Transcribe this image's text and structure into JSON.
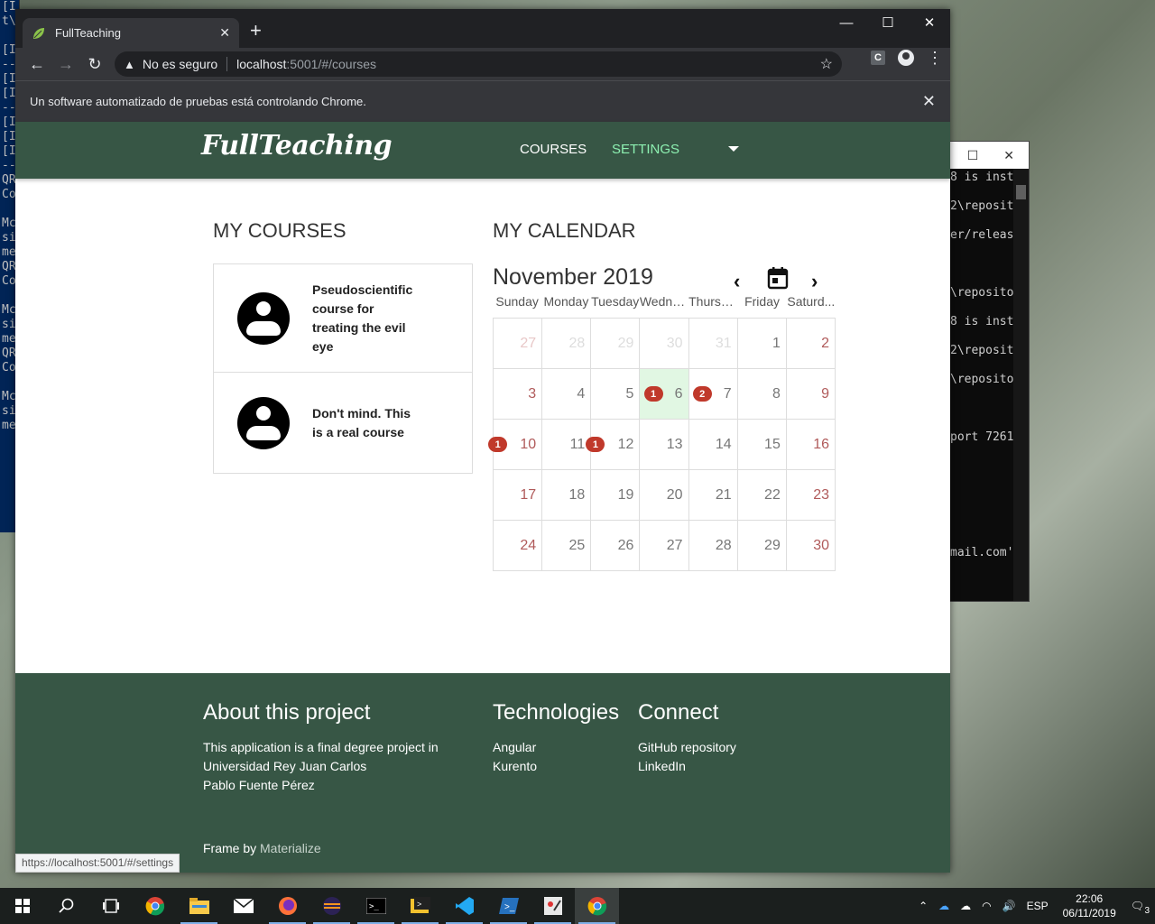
{
  "background": {
    "ps_lines": [
      "[I",
      "t\\",
      "",
      "[I",
      "--",
      "[I",
      "[I",
      "--",
      "[I",
      "[I",
      "[I",
      "--",
      "QR",
      "Co",
      "",
      "Mc",
      "si",
      "me",
      "QR",
      "Co",
      "",
      "Mc",
      "si",
      "me",
      "QR",
      "Co",
      "",
      "Mc",
      "si",
      "me"
    ],
    "cmd_lines": [
      "8 is inst",
      "2\\reposit",
      "er/releas",
      "\\reposito",
      "8 is inst",
      "2\\reposit",
      "\\reposito",
      "port 7261",
      "mail.com'"
    ],
    "cmd_controls": {
      "maximize": "☐",
      "close": "✕"
    }
  },
  "browser": {
    "tab_title": "FullTeaching",
    "tab_close": "✕",
    "new_tab": "+",
    "window_controls": [
      "—",
      "☐",
      "✕"
    ],
    "nav": {
      "back": "←",
      "forward": "→",
      "reload": "↻"
    },
    "security_text": "No es seguro",
    "url_host": "localhost",
    "url_rest": ":5001/#/courses",
    "ext_label": "C",
    "menu": "⋮",
    "infobar_text": "Un software automatizado de pruebas está controlando Chrome.",
    "status_url": "https://localhost:5001/#/settings"
  },
  "site": {
    "brand": "FullTeaching",
    "nav": {
      "courses": "COURSES",
      "settings": "SETTINGS"
    },
    "my_courses_title": "MY COURSES",
    "courses": [
      {
        "name": "Pseudoscientific course for treating the evil eye"
      },
      {
        "name": "Don't mind. This is a real course"
      }
    ],
    "my_calendar_title": "MY CALENDAR",
    "calendar": {
      "month": "November 2019",
      "prev": "‹",
      "next": "›",
      "day_headers": [
        "Sunday",
        "Monday",
        "Tuesday",
        "Wedne...",
        "Thursd...",
        "Friday",
        "Saturd..."
      ]
    },
    "footer": {
      "about_title": "About this project",
      "about_lines": [
        "This application is a final degree project in",
        "Universidad Rey Juan Carlos",
        "Pablo Fuente Pérez"
      ],
      "tech_title": "Technologies",
      "tech_items": [
        "Angular",
        "Kurento"
      ],
      "connect_title": "Connect",
      "connect_items": [
        "GitHub repository",
        "LinkedIn"
      ],
      "frame_by": "Frame by",
      "materialize": "Materialize"
    }
  },
  "calendar_cells": [
    {
      "day": "27",
      "muted": true,
      "weekend": true
    },
    {
      "day": "28",
      "muted": true
    },
    {
      "day": "29",
      "muted": true
    },
    {
      "day": "30",
      "muted": true
    },
    {
      "day": "31",
      "muted": true
    },
    {
      "day": "1"
    },
    {
      "day": "2",
      "weekend": true
    },
    {
      "day": "3",
      "weekend": true
    },
    {
      "day": "4"
    },
    {
      "day": "5"
    },
    {
      "day": "6",
      "today": true,
      "badge": "1"
    },
    {
      "day": "7",
      "badge": "2"
    },
    {
      "day": "8"
    },
    {
      "day": "9",
      "weekend": true
    },
    {
      "day": "10",
      "weekend": true,
      "badge": "1"
    },
    {
      "day": "11"
    },
    {
      "day": "12",
      "badge": "1"
    },
    {
      "day": "13"
    },
    {
      "day": "14"
    },
    {
      "day": "15"
    },
    {
      "day": "16",
      "weekend": true
    },
    {
      "day": "17",
      "weekend": true
    },
    {
      "day": "18"
    },
    {
      "day": "19"
    },
    {
      "day": "20"
    },
    {
      "day": "21"
    },
    {
      "day": "22"
    },
    {
      "day": "23",
      "weekend": true
    },
    {
      "day": "24",
      "weekend": true
    },
    {
      "day": "25"
    },
    {
      "day": "26"
    },
    {
      "day": "27"
    },
    {
      "day": "28"
    },
    {
      "day": "29"
    },
    {
      "day": "30",
      "weekend": true
    }
  ],
  "taskbar": {
    "apps": [
      "windows-start",
      "search",
      "task-view",
      "chrome",
      "file-explorer",
      "mail",
      "firefox",
      "eclipse",
      "cmd",
      "powershell-ise",
      "vscode",
      "powershell",
      "paint",
      "chrome-active"
    ],
    "lang": "ESP",
    "time": "22:06",
    "date": "06/11/2019",
    "notifications": "3"
  },
  "colors": {
    "nav_green": "#375645",
    "settings_accent": "#8df0b1",
    "badge_red": "#c0392b",
    "today_bg": "#e1f7e3"
  }
}
